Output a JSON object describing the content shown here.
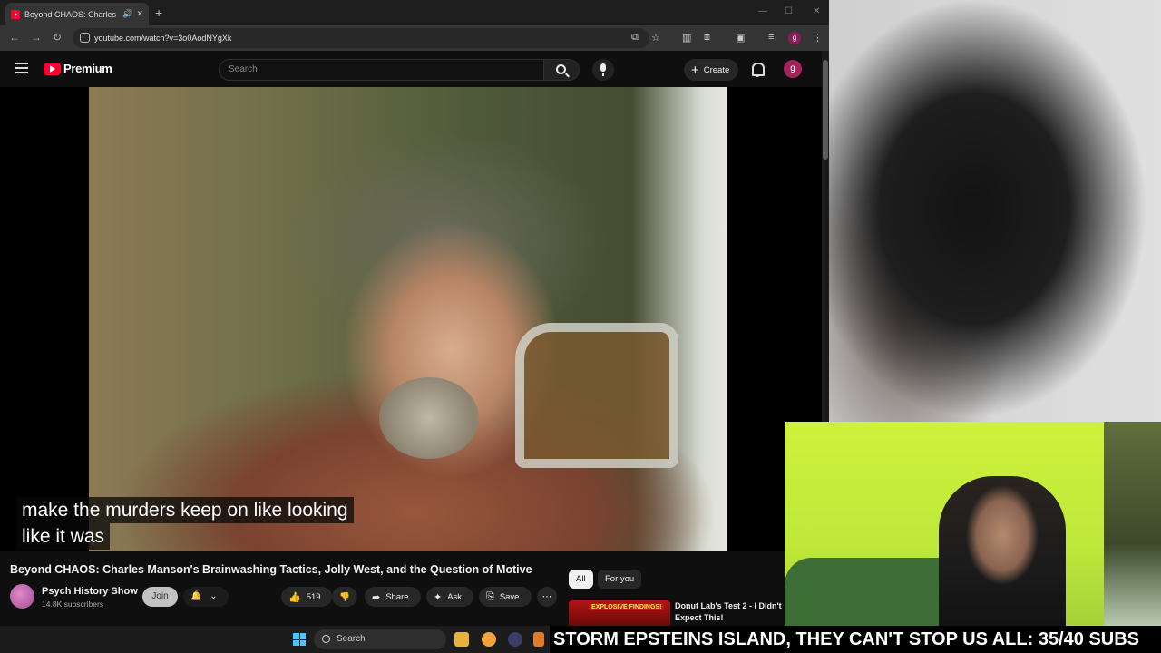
{
  "browser": {
    "tab_title": "Beyond CHAOS: Charles M",
    "url": "youtube.com/watch?v=3o0AodNYgXk",
    "profile_initial": "g"
  },
  "youtube": {
    "brand": "Premium",
    "search_placeholder": "Search",
    "create_label": "Create",
    "avatar_initial": "g"
  },
  "player": {
    "caption_lines": [
      "make the murders keep on like looking",
      "like it was"
    ]
  },
  "video": {
    "title": "Beyond CHAOS: Charles Manson's Brainwashing Tactics, Jolly West, and the Question of Motive",
    "channel_name": "Psych History Show",
    "subscribers": "14.8K subscribers",
    "join_label": "Join",
    "like_count": "519",
    "share_label": "Share",
    "ask_label": "Ask",
    "save_label": "Save"
  },
  "sidebar": {
    "chips": [
      "All",
      "For you"
    ],
    "rec_title": "Donut Lab's Test 2 - I Didn't Expect This!",
    "rec_thumb_text": "EXPLOSIVE FINDINGS!"
  },
  "stream": {
    "ticker": "STORM EPSTEINS ISLAND, THEY CAN'T STOP US ALL: 35/40 SUBS"
  },
  "taskbar": {
    "search_label": "Search"
  },
  "colors": {
    "yt_red": "#ff0033",
    "dark_bg": "#0f0f0f",
    "green_screen": "#cdf23c"
  }
}
